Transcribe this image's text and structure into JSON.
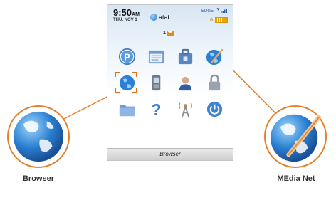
{
  "status_bar": {
    "time": "9:50",
    "ampm": "AM",
    "date": "THU, NOV 1",
    "carrier": "atat",
    "network": "EDGE",
    "battery_count": "0"
  },
  "messages": {
    "count": "1"
  },
  "home_icons": [
    {
      "name": "pocket-app-icon"
    },
    {
      "name": "calendar-icon"
    },
    {
      "name": "briefcase-icon"
    },
    {
      "name": "media-net-icon"
    },
    {
      "name": "browser-icon",
      "selected": true
    },
    {
      "name": "phone-icon"
    },
    {
      "name": "contacts-icon"
    },
    {
      "name": "lock-icon"
    },
    {
      "name": "folder-icon"
    },
    {
      "name": "help-icon"
    },
    {
      "name": "wireless-tower-icon"
    },
    {
      "name": "power-icon"
    }
  ],
  "bottom_bar": {
    "label": "Browser"
  },
  "callouts": {
    "left_label": "Browser",
    "right_label": "MEdia Net"
  },
  "colors": {
    "accent": "#e67f2a",
    "globe_blue": "#2a7fd0"
  }
}
